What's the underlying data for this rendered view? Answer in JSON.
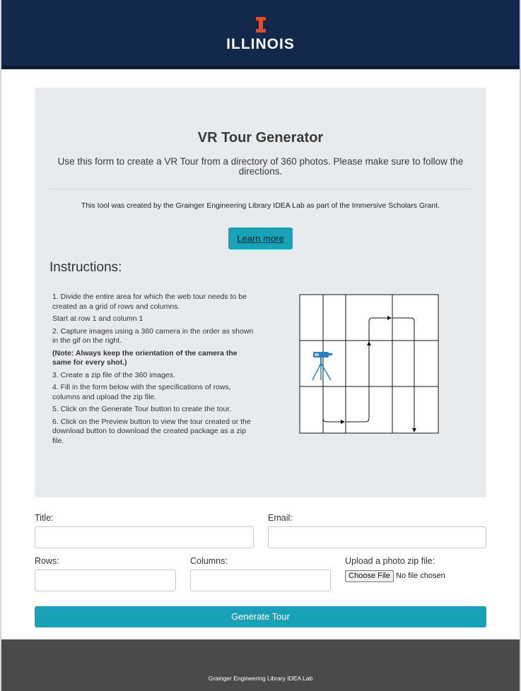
{
  "header": {
    "brand": "ILLINOIS",
    "brand_color": "#e84a27",
    "background": "#13294b"
  },
  "hero": {
    "title": "VR Tour Generator",
    "lead": "Use this form to create a VR Tour from a directory of 360 photos. Please make sure to follow the directions.",
    "credit": "This tool was created by the Grainger Engineering Library IDEA Lab as part of the Immersive Scholars Grant.",
    "learn_more_label": "Learn more"
  },
  "instructions": {
    "heading": "Instructions:",
    "steps": [
      "1. Divide the entire area for which the web tour needs to be created as a grid of rows and columns.",
      "Start at row 1 and column 1",
      "2. Capture images using a 360 camera in the order as shown in the gif on the right.",
      "(Note: Always keep the orientation of the camera the same for every shot.)",
      "3. Create a zip file of the 360 images.",
      "4. Fill in the form below with the specifications of rows, columns and upload the zip file.",
      "5. Click on the Generate Tour button to create the tour.",
      "6. Click on the Preview button to view the tour created or the download button to download the created package as a zip file."
    ],
    "diagram_icon": "camera-tripod-icon"
  },
  "form": {
    "title_label": "Title:",
    "title_value": "",
    "email_label": "Email:",
    "email_value": "",
    "rows_label": "Rows:",
    "rows_value": "",
    "columns_label": "Columns:",
    "columns_value": "",
    "upload_label": "Upload a photo zip file:",
    "choose_file_label": "Choose File",
    "file_status": "No file chosen",
    "generate_label": "Generate Tour",
    "accent": "#17a2b8"
  },
  "footer": {
    "text": "Grainger Engineering Library IDEA Lab"
  }
}
